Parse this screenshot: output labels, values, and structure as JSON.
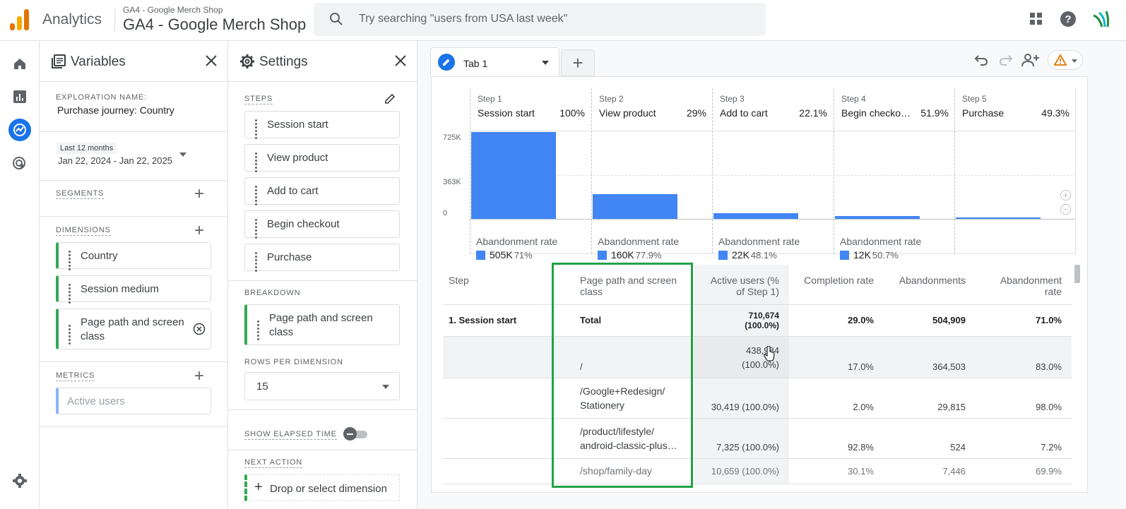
{
  "header": {
    "app_name": "Analytics",
    "property_small": "GA4 - Google Merch Shop",
    "property_big": "GA4 - Google Merch Shop",
    "search_placeholder": "Try searching \"users from USA last week\""
  },
  "variables": {
    "title": "Variables",
    "exploration_label": "EXPLORATION NAME:",
    "exploration_name": "Purchase journey: Country",
    "date_chip": "Last 12 months",
    "date_range": "Jan 22, 2024 - Jan 22, 2025",
    "segments_label": "SEGMENTS",
    "dimensions_label": "DIMENSIONS",
    "dimensions": [
      "Country",
      "Session medium",
      "Page path and screen class"
    ],
    "metrics_label": "METRICS",
    "metrics": [
      "Active users"
    ]
  },
  "settings": {
    "title": "Settings",
    "steps_label": "STEPS",
    "steps": [
      "Session start",
      "View product",
      "Add to cart",
      "Begin checkout",
      "Purchase"
    ],
    "breakdown_label": "BREAKDOWN",
    "breakdown_value": "Page path and screen class",
    "rows_label": "ROWS PER DIMENSION",
    "rows_value": "15",
    "elapsed_label": "SHOW ELAPSED TIME",
    "next_action_label": "NEXT ACTION",
    "next_action_placeholder": "Drop or select dimension"
  },
  "tab": {
    "label": "Tab 1"
  },
  "funnel": {
    "y_ticks": [
      "725K",
      "363K",
      "0"
    ],
    "steps": [
      {
        "num": "Step 1",
        "name": "Session start",
        "pct": "100%",
        "value": 710674,
        "aband_label": "Abandonment rate",
        "aband_count": "505K",
        "aband_pct": "71%"
      },
      {
        "num": "Step 2",
        "name": "View product",
        "pct": "29%",
        "value": 205765,
        "aband_label": "Abandonment rate",
        "aband_count": "160K",
        "aband_pct": "77.9%"
      },
      {
        "num": "Step 3",
        "name": "Add to cart",
        "pct": "22.1%",
        "value": 45475,
        "aband_label": "Abandonment rate",
        "aband_count": "22K",
        "aband_pct": "48.1%"
      },
      {
        "num": "Step 4",
        "name": "Begin checko…",
        "pct": "51.9%",
        "value": 23601,
        "aband_label": "Abandonment rate",
        "aband_count": "12K",
        "aband_pct": "50.7%"
      },
      {
        "num": "Step 5",
        "name": "Purchase",
        "pct": "49.3%",
        "value": 11636,
        "aband_label": "",
        "aband_count": "",
        "aband_pct": ""
      }
    ],
    "y_max": 725000
  },
  "table": {
    "headers": [
      "Step",
      "Page path and screen class",
      "Active users (% of Step 1)",
      "Completion rate",
      "Abandonments",
      "Abandonment rate"
    ],
    "rows": [
      {
        "step": "1. Session start",
        "path": "Total",
        "active_users": "710,674",
        "active_pct": "(100.0%)",
        "completion": "29.0%",
        "abandonments": "504,909",
        "aband_rate": "71.0%"
      },
      {
        "step": "",
        "path": "/",
        "active_users": "438,984",
        "active_pct": "(100.0%)",
        "completion": "17.0%",
        "abandonments": "364,503",
        "aband_rate": "83.0%"
      },
      {
        "step": "",
        "path": "/Google+Redesign/ Stationery",
        "active_users": "30,419 (100.0%)",
        "active_pct": "",
        "completion": "2.0%",
        "abandonments": "29,815",
        "aband_rate": "98.0%"
      },
      {
        "step": "",
        "path": "/product/lifestyle/ android-classic-plus…",
        "active_users": "7,325 (100.0%)",
        "active_pct": "",
        "completion": "92.8%",
        "abandonments": "524",
        "aband_rate": "7.2%"
      },
      {
        "step": "",
        "path": "/shop/family-day",
        "active_users": "10,659 (100.0%)",
        "active_pct": "",
        "completion": "30.1%",
        "abandonments": "7,446",
        "aband_rate": "69.9%"
      }
    ]
  },
  "colors": {
    "bar": "#4285f4",
    "highlight_box": "#1fa347",
    "rail_active": "#1a73e8"
  }
}
